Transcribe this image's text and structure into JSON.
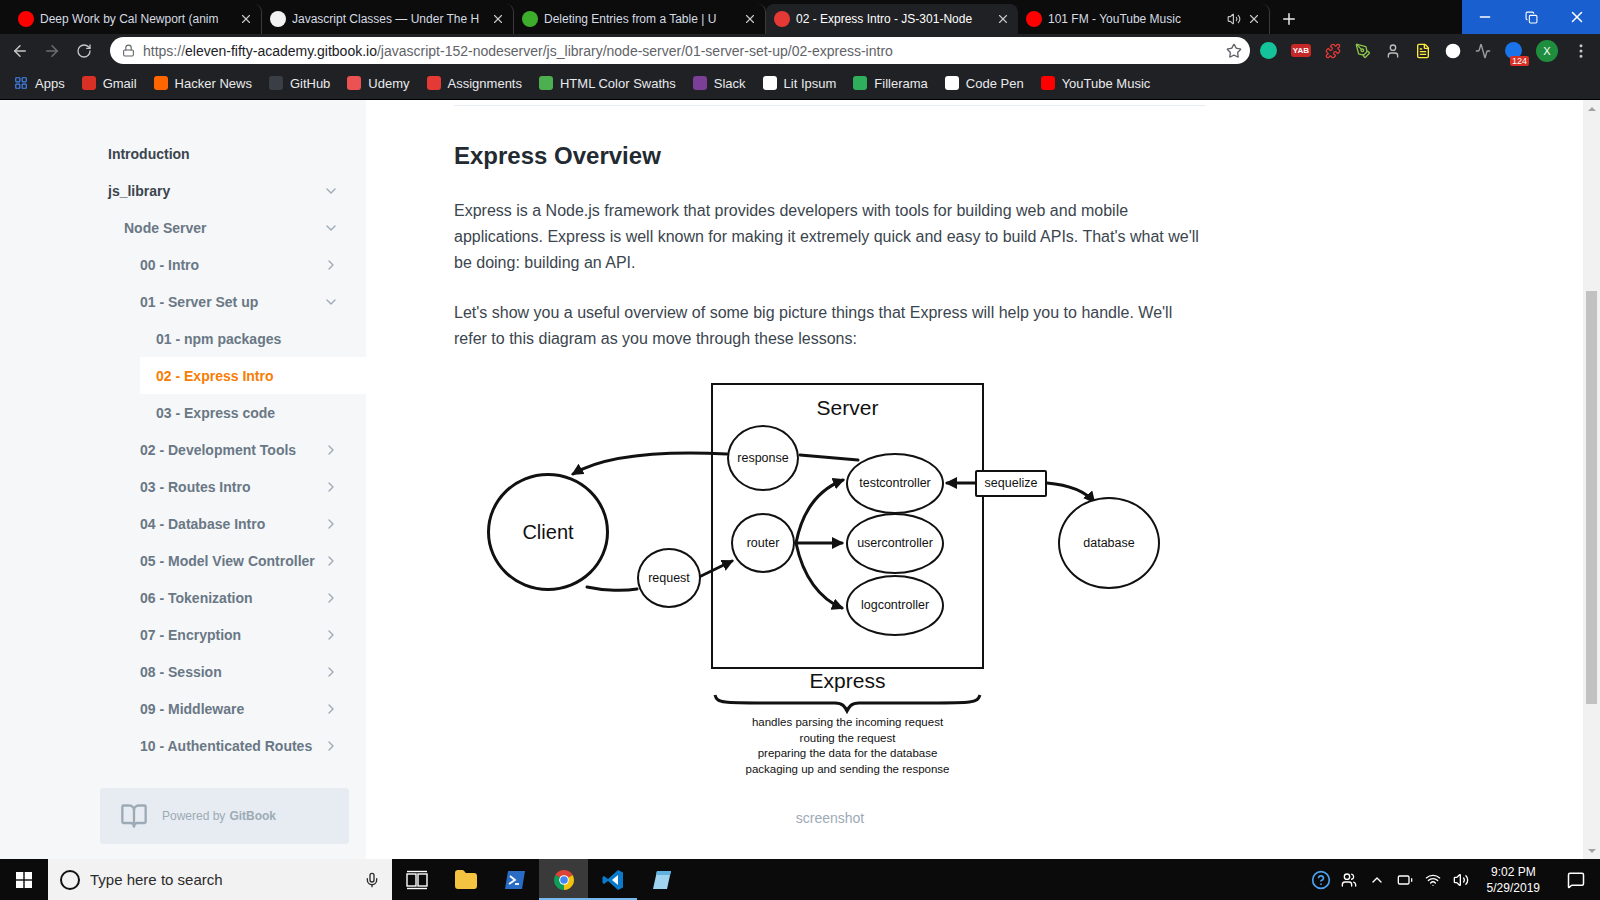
{
  "browser": {
    "tabs": [
      {
        "label": "Deep Work by Cal Newport (anim",
        "selected": false,
        "audio": false,
        "color": "#ff0000"
      },
      {
        "label": "Javascript Classes — Under The H",
        "selected": false,
        "audio": false,
        "color": "#f2f2f2"
      },
      {
        "label": "Deleting Entries from a Table | U",
        "selected": false,
        "audio": false,
        "color": "#3dae2b"
      },
      {
        "label": "02 - Express Intro - JS-301-Node",
        "selected": true,
        "audio": false,
        "color": "#e53935"
      },
      {
        "label": "101 FM - YouTube Music",
        "selected": false,
        "audio": true,
        "color": "#ff0000"
      }
    ],
    "address": {
      "scheme": "https://",
      "host": "eleven-fifty-academy.gitbook.io",
      "path": "/javascript-152-nodeserver/js_library/node-server/01-server-set-up/02-express-intro"
    },
    "toolbar": {
      "extension_label": "YAB",
      "notification_count": "124",
      "profile_initial": "X"
    },
    "bookmarks": [
      {
        "label": "Apps",
        "kind": "apps",
        "color": "#4285f4"
      },
      {
        "label": "Gmail",
        "kind": "site",
        "color": "#d93025"
      },
      {
        "label": "Hacker News",
        "kind": "site",
        "color": "#ff6600"
      },
      {
        "label": "GitHub",
        "kind": "site",
        "color": "#3a3f45"
      },
      {
        "label": "Udemy",
        "kind": "site",
        "color": "#ec5252"
      },
      {
        "label": "Assignments",
        "kind": "site",
        "color": "#e53935"
      },
      {
        "label": "HTML Color Swaths",
        "kind": "site",
        "color": "#4caf50"
      },
      {
        "label": "Slack",
        "kind": "site",
        "color": "#7b3f98"
      },
      {
        "label": "Lit Ipsum",
        "kind": "site",
        "color": "#ffffff"
      },
      {
        "label": "Fillerama",
        "kind": "site",
        "color": "#2fae5c"
      },
      {
        "label": "Code Pen",
        "kind": "site",
        "color": "#ffffff"
      },
      {
        "label": "YouTube Music",
        "kind": "site",
        "color": "#ff0000"
      }
    ]
  },
  "sidebar": {
    "items": [
      {
        "label": "Introduction",
        "level": 0,
        "kind": "page",
        "selected": false
      },
      {
        "label": "js_library",
        "level": 0,
        "kind": "group",
        "expanded": true,
        "selected": false
      },
      {
        "label": "Node Server",
        "level": 1,
        "kind": "group",
        "expanded": true,
        "selected": false
      },
      {
        "label": "00 - Intro",
        "level": 2,
        "kind": "group",
        "expanded": false,
        "selected": false
      },
      {
        "label": "01 - Server Set up",
        "level": 2,
        "kind": "group",
        "expanded": true,
        "selected": false
      },
      {
        "label": "01 - npm packages",
        "level": 3,
        "kind": "page",
        "selected": false
      },
      {
        "label": "02 - Express Intro",
        "level": 3,
        "kind": "page",
        "selected": true
      },
      {
        "label": "03 - Express code",
        "level": 3,
        "kind": "page",
        "selected": false
      },
      {
        "label": "02 - Development Tools",
        "level": 2,
        "kind": "group",
        "expanded": false,
        "selected": false
      },
      {
        "label": "03 - Routes Intro",
        "level": 2,
        "kind": "group",
        "expanded": false,
        "selected": false
      },
      {
        "label": "04 - Database Intro",
        "level": 2,
        "kind": "group",
        "expanded": false,
        "selected": false
      },
      {
        "label": "05 - Model View Controller",
        "level": 2,
        "kind": "group",
        "expanded": false,
        "selected": false
      },
      {
        "label": "06 - Tokenization",
        "level": 2,
        "kind": "group",
        "expanded": false,
        "selected": false
      },
      {
        "label": "07 - Encryption",
        "level": 2,
        "kind": "group",
        "expanded": false,
        "selected": false
      },
      {
        "label": "08 - Session",
        "level": 2,
        "kind": "group",
        "expanded": false,
        "selected": false
      },
      {
        "label": "09 - Middleware",
        "level": 2,
        "kind": "group",
        "expanded": false,
        "selected": false
      },
      {
        "label": "10 - Authenticated Routes",
        "level": 2,
        "kind": "group",
        "expanded": false,
        "selected": false
      }
    ],
    "footer": {
      "prefix": "Powered by",
      "brand": "GitBook"
    }
  },
  "article": {
    "heading": "Express Overview",
    "paragraphs": [
      "Express is a Node.js framework that provides developers with tools for building web and mobile applications. Express is well known for making it extremely quick and easy to build APIs. That's what we'll be doing: building an API.",
      "Let's show you a useful overview of some big picture things that Express will help you to handle. We'll refer to this diagram as you move through these lessons:"
    ],
    "figure": {
      "container": "Server",
      "framework": "Express",
      "nodes": [
        {
          "label": "Client",
          "kind": "ellipse"
        },
        {
          "label": "request",
          "kind": "ellipse"
        },
        {
          "label": "response",
          "kind": "ellipse"
        },
        {
          "label": "router",
          "kind": "ellipse"
        },
        {
          "label": "testcontroller",
          "kind": "ellipse"
        },
        {
          "label": "usercontroller",
          "kind": "ellipse"
        },
        {
          "label": "logcontroller",
          "kind": "ellipse"
        },
        {
          "label": "sequelize",
          "kind": "box"
        },
        {
          "label": "database",
          "kind": "ellipse"
        }
      ],
      "notes": [
        "handles parsing the incoming request",
        "routing the request",
        "preparing the data for the database",
        "packaging up and sending the response"
      ]
    },
    "caption": "screenshot"
  },
  "scrollbar": {
    "offset": 0.24,
    "size": 0.57
  },
  "taskbar": {
    "search": {
      "placeholder": "Type here to search"
    },
    "apps": [
      {
        "kind": "task-view",
        "selected": false,
        "open": false
      },
      {
        "kind": "explorer",
        "selected": false,
        "open": false
      },
      {
        "kind": "powershell",
        "selected": false,
        "open": false
      },
      {
        "kind": "chrome",
        "selected": true,
        "open": true
      },
      {
        "kind": "vscode",
        "selected": false,
        "open": true
      },
      {
        "kind": "notes",
        "selected": false,
        "open": false
      }
    ],
    "clock": {
      "time": "9:02 PM",
      "date": "5/29/2019"
    }
  }
}
